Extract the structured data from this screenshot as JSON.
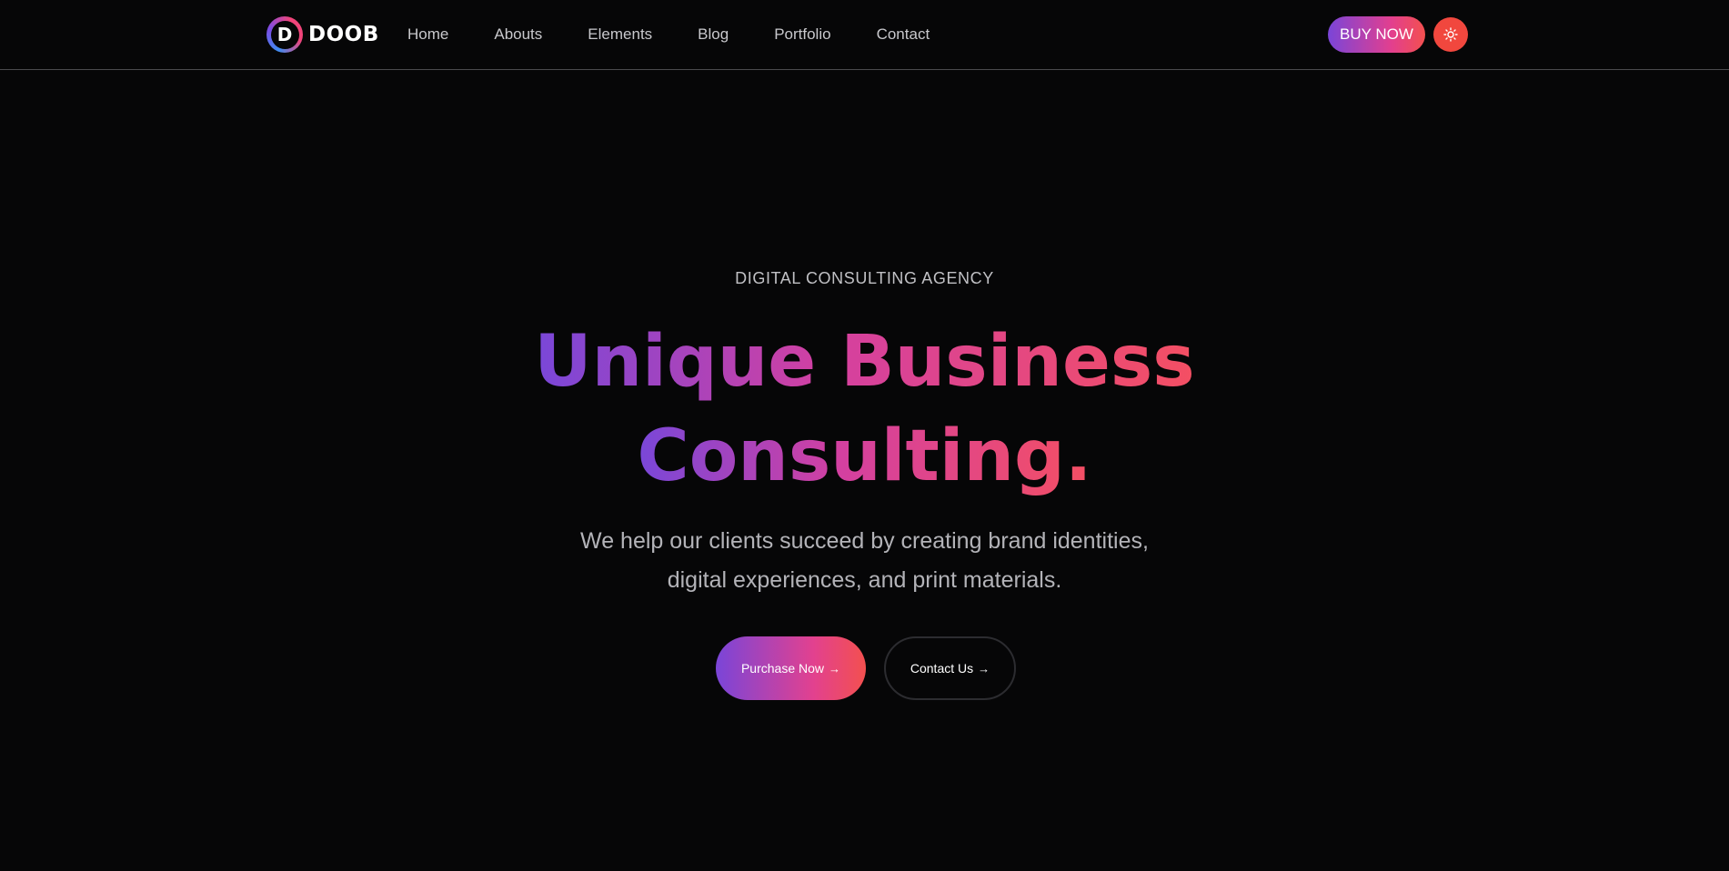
{
  "header": {
    "logo": {
      "mark_letter": "D",
      "text": "DOOB"
    },
    "nav": [
      {
        "label": "Home"
      },
      {
        "label": "Abouts"
      },
      {
        "label": "Elements"
      },
      {
        "label": "Blog"
      },
      {
        "label": "Portfolio"
      },
      {
        "label": "Contact"
      }
    ],
    "buy_button_label": "BUY NOW",
    "theme_toggle_icon": "sun-icon"
  },
  "hero": {
    "subtitle": "DIGITAL CONSULTING AGENCY",
    "title_line1": "Unique Business",
    "title_line2": "Consulting.",
    "description_line1": "We help our clients succeed by creating brand identities,",
    "description_line2": "digital experiences, and print materials.",
    "purchase_button_label": "Purchase Now",
    "contact_button_label": "Contact Us",
    "arrow_glyph": "→"
  },
  "colors": {
    "background": "#060607",
    "gradient_start": "#7947d9",
    "gradient_end": "#f44f63",
    "theme_button": "#f1473e"
  }
}
